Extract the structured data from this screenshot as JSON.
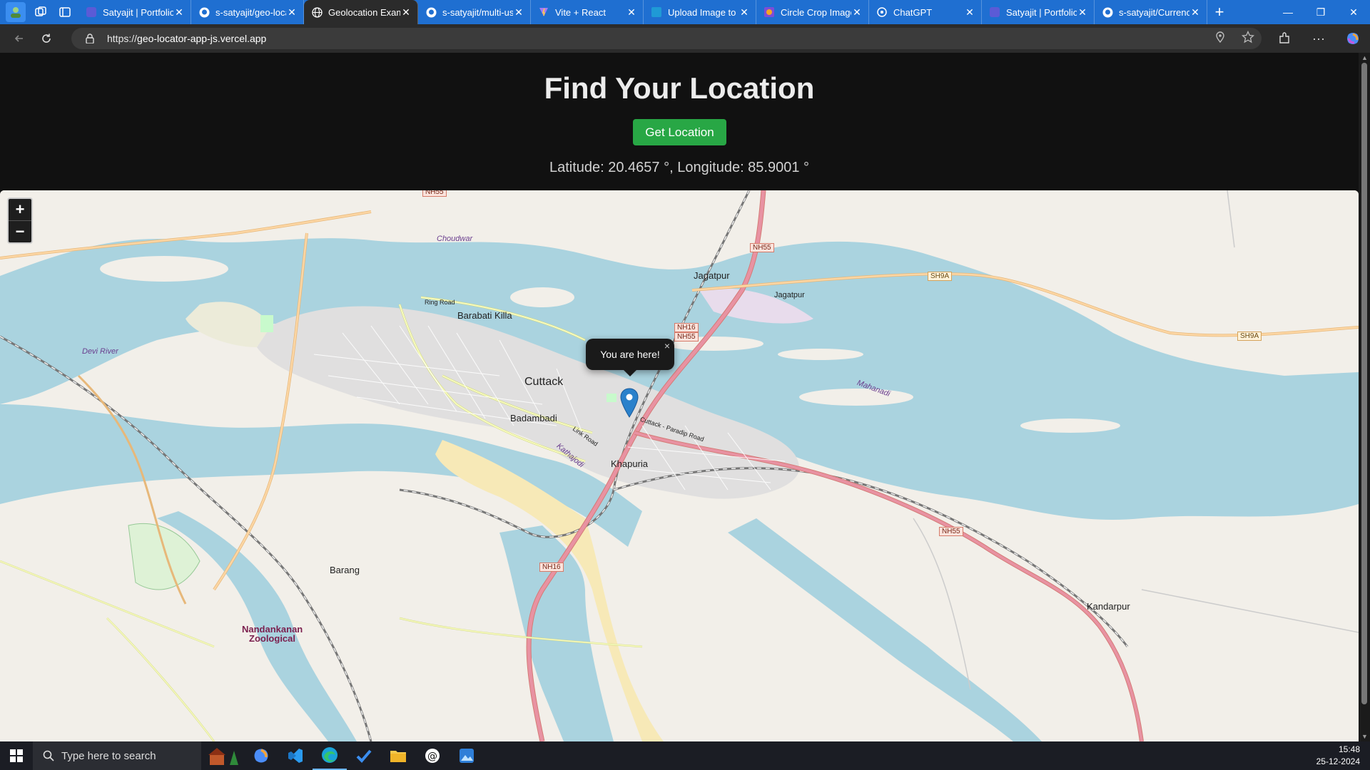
{
  "browser": {
    "tabs": [
      {
        "title": "Satyajit | Portfolio",
        "icon": "portfolio-icon",
        "active": false
      },
      {
        "title": "s-satyajit/geo-loca",
        "icon": "github-icon",
        "active": false
      },
      {
        "title": "Geolocation Exam",
        "icon": "globe-icon",
        "active": true
      },
      {
        "title": "s-satyajit/multi-us",
        "icon": "github-icon",
        "active": false
      },
      {
        "title": "Vite + React",
        "icon": "vite-icon",
        "active": false
      },
      {
        "title": "Upload Image to I",
        "icon": "upload-icon",
        "active": false
      },
      {
        "title": "Circle Crop Image",
        "icon": "crop-icon",
        "active": false
      },
      {
        "title": "ChatGPT",
        "icon": "chatgpt-icon",
        "active": false
      },
      {
        "title": "Satyajit | Portfolio",
        "icon": "portfolio-icon",
        "active": false
      },
      {
        "title": "s-satyajit/Currenc",
        "icon": "github-icon",
        "active": false
      }
    ],
    "url_prefix": "https://",
    "url_host": "geo-locator-app-js.vercel.app"
  },
  "page": {
    "title": "Find Your Location",
    "button_label": "Get Location",
    "coords_text": "Latitude: 20.4657 °, Longitude: 85.9001 °"
  },
  "map": {
    "zoom_in": "+",
    "zoom_out": "−",
    "popup_text": "You are here!",
    "popup_close": "×",
    "labels": {
      "cuttack": "Cuttack",
      "barabati": "Barabati Killa",
      "badambadi": "Badambadi",
      "khapuria": "Khapuria",
      "jagatpur1": "Jagatpur",
      "jagatpur2": "Jagatpur",
      "barang": "Barang",
      "kandarpur": "Kandarpur",
      "nandankanan": "Nandankanan",
      "zoological": "Zoological",
      "choudwar": "Choudwar",
      "devi_river": "Devi River",
      "mahanadi": "Mahanadi",
      "ring_road": "Ring Road",
      "link_road": "Link Road",
      "cuttack_paradip": "Cuttack - Paradip Road",
      "kathajodi": "Kathajodi"
    },
    "shields": {
      "nh55_top": "NH55",
      "nh55_a": "NH55",
      "nh16": "NH16",
      "nh55_b": "NH55",
      "nh16_south": "NH16",
      "nh55_east": "NH55",
      "sh9a_1": "SH9A",
      "sh9a_2": "SH9A"
    },
    "colors": {
      "water": "#aad3df",
      "land": "#f2efe9",
      "urban": "#e0dfdf",
      "trunk": "#e892a2",
      "primary": "#fcd6a4",
      "secondary": "#f7fabf"
    }
  },
  "taskbar": {
    "search_placeholder": "Type here to search",
    "time": "15:48",
    "date": "25-12-2024",
    "apps": [
      "copilot-icon",
      "vscode-icon",
      "edge-icon",
      "todo-icon",
      "file-explorer-icon",
      "threads-icon",
      "photos-icon"
    ]
  }
}
